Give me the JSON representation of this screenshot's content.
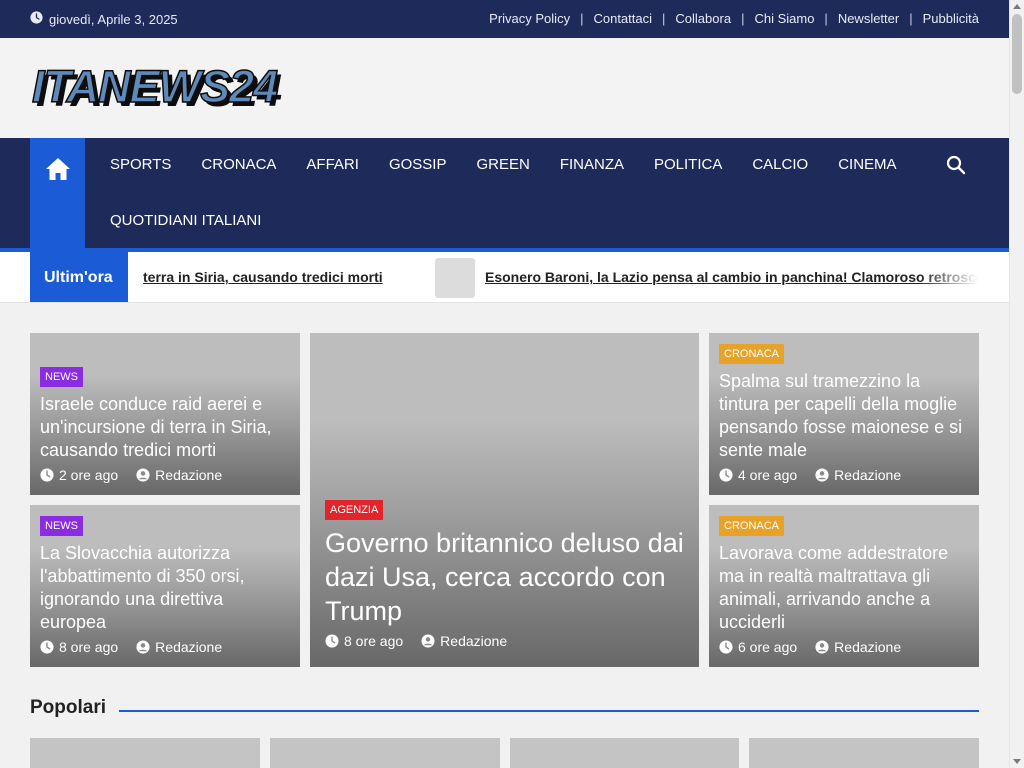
{
  "topbar": {
    "date": "giovedì, Aprile 3, 2025",
    "links": [
      "Privacy Policy",
      "Contattaci",
      "Collabora",
      "Chi Siamo",
      "Newsletter",
      "Pubblicità"
    ],
    "separator": "|"
  },
  "logo": {
    "text": "ITANEWS24"
  },
  "nav": {
    "items": [
      "SPORTS",
      "CRONACA",
      "AFFARI",
      "GOSSIP",
      "GREEN",
      "FINANZA",
      "POLITICA",
      "CALCIO",
      "CINEMA",
      "QUOTIDIANI ITALIANI"
    ]
  },
  "ticker": {
    "label": "Ultim'ora",
    "items": [
      "terra in Siria, causando tredici morti",
      "Esonero Baroni, la Lazio pensa al cambio in panchina! Clamoroso retroscena"
    ]
  },
  "cards": [
    {
      "category": "NEWS",
      "title": "Israele conduce raid aerei e un'incursione di terra in Siria, causando tredici morti",
      "time": "2 ore ago",
      "author": "Redazione"
    },
    {
      "category": "NEWS",
      "title": "La Slovacchia autorizza l'abbattimento di 350 orsi, ignorando una direttiva europea",
      "time": "8 ore ago",
      "author": "Redazione"
    },
    {
      "category": "AGENZIA",
      "title": "Governo britannico deluso dai dazi Usa, cerca accordo con Trump",
      "time": "8 ore ago",
      "author": "Redazione"
    },
    {
      "category": "CRONACA",
      "title": "Spalma sul tramezzino la tintura per capelli della moglie pensando fosse maionese e si sente male",
      "time": "4 ore ago",
      "author": "Redazione"
    },
    {
      "category": "CRONACA",
      "title": "Lavorava come addestratore ma in realtà maltrattava gli animali, arrivando anche a ucciderli",
      "time": "6 ore ago",
      "author": "Redazione"
    }
  ],
  "popolari": {
    "title": "Popolari"
  },
  "colors": {
    "navy": "#1e2a5a",
    "accent_blue": "#1c5bd6",
    "news": "#8b2be2",
    "agenzia": "#e2252b",
    "cronaca": "#e8a227"
  }
}
